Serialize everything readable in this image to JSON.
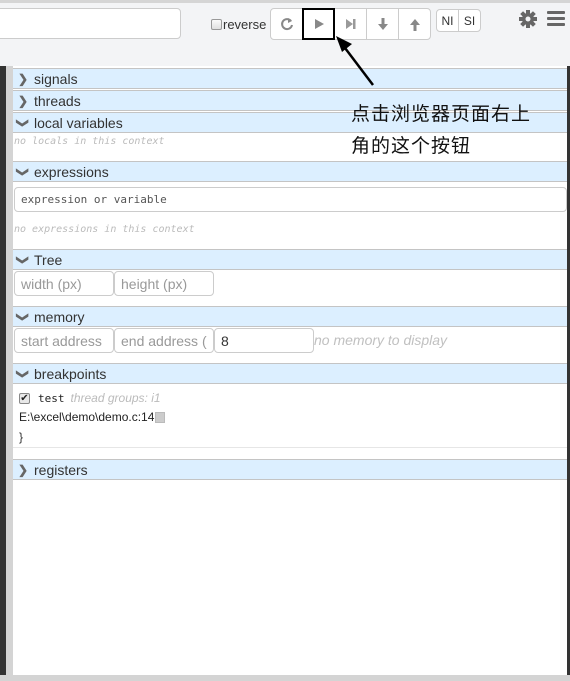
{
  "toolbar": {
    "command_input_value": "",
    "reverse_label": "reverse",
    "reverse_checked": false,
    "buttons": [
      {
        "name": "refresh",
        "glyph": "↻"
      },
      {
        "name": "continue",
        "glyph": "▶"
      },
      {
        "name": "next",
        "glyph": "▶|"
      },
      {
        "name": "step",
        "glyph": "↓"
      },
      {
        "name": "return",
        "glyph": "↑"
      }
    ],
    "ni_label": "NI",
    "si_label": "SI"
  },
  "annotation": {
    "line1": "点击浏览器页面右上",
    "line2": "角的这个按钮"
  },
  "sections": {
    "signals": {
      "label": "signals",
      "expanded": false
    },
    "threads": {
      "label": "threads",
      "expanded": false
    },
    "local_variables": {
      "label": "local variables",
      "expanded": true,
      "empty_text": "no locals in this context"
    },
    "expressions": {
      "label": "expressions",
      "expanded": true,
      "placeholder": "expression or variable",
      "empty_text": "no expressions in this context"
    },
    "tree": {
      "label": "Tree",
      "expanded": true,
      "width_placeholder": "width (px)",
      "height_placeholder": "height (px)"
    },
    "memory": {
      "label": "memory",
      "expanded": true,
      "start_placeholder": "start address",
      "end_placeholder": "end address (",
      "bytes_value": "8",
      "empty_text": "no memory to display"
    },
    "breakpoints": {
      "label": "breakpoints",
      "expanded": true,
      "items": [
        {
          "enabled": true,
          "name": "test",
          "thread_groups": "thread groups: i1",
          "location": "E:\\excel\\demo\\demo.c:14",
          "closing": "}"
        }
      ]
    },
    "registers": {
      "label": "registers",
      "expanded": false
    }
  }
}
